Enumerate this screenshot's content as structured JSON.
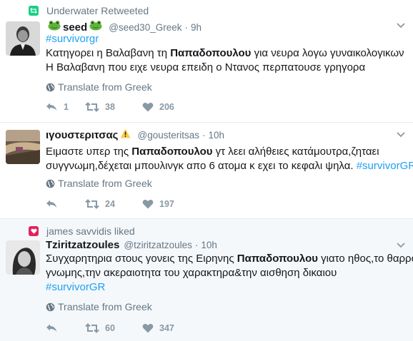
{
  "tweets": [
    {
      "context": "Underwater Retweeted",
      "context_type": "retweet",
      "fullname": "seed",
      "username": "@seed30_Greek",
      "time": "9h",
      "lines": [
        [
          {
            "t": "#survivorgr",
            "tag": true
          }
        ],
        [
          {
            "t": "Κατηγορει η Βαλαβανη τη "
          },
          {
            "t": "Παπαδοπουλου",
            "b": true
          },
          {
            "t": " για νευρα λογω γυναικολογικων"
          }
        ],
        [
          {
            "t": "Η Βαλαβανη που ειχε νευρα επειδη ο Ντανος περπατουσε γρηγορα"
          }
        ]
      ],
      "translate": "Translate from Greek",
      "replies": "1",
      "retweets": "38",
      "likes": "206"
    },
    {
      "fullname": "ιγουστεριτσας",
      "username": "@gousteritsas",
      "time": "10h",
      "lines": [
        [
          {
            "t": "Ειμαστε υπερ της "
          },
          {
            "t": "Παπαδοπουλου",
            "b": true
          },
          {
            "t": " γτ λεει αλήθειες κατάμουτρα,ζηταει"
          }
        ],
        [
          {
            "t": "συγγνωμη,δέχεται μπουλινγκ απο 6 ατομα κ εχει το κεφαλι ψηλα. "
          },
          {
            "t": "#survivorGR",
            "tag": true
          }
        ]
      ],
      "translate": "Translate from Greek",
      "replies": "",
      "retweets": "24",
      "likes": "197"
    },
    {
      "context": "james savvidis liked",
      "context_type": "like",
      "fullname": "Tziritzatzoules",
      "username": "@tziritzatzoules",
      "time": "10h",
      "lines": [
        [
          {
            "t": "Συγχαρητηρια στους γονεις της Ειρηνης "
          },
          {
            "t": "Παπαδοπουλου",
            "b": true
          },
          {
            "t": " γιατο ηθος,το θαρρος"
          }
        ],
        [
          {
            "t": "γνωμης,την ακεραιοτητα του χαρακτηρα&την αισθηση δικαιου"
          }
        ],
        [
          {
            "t": "#survivorGR",
            "tag": true
          }
        ]
      ],
      "translate": "Translate from Greek",
      "replies": "",
      "retweets": "60",
      "likes": "347"
    }
  ],
  "colors": {
    "retweet_green": "#19cf86",
    "like_red": "#e0245e",
    "link_blue": "#1da1f2",
    "muted": "#657786",
    "action_gray": "#8899a6"
  }
}
